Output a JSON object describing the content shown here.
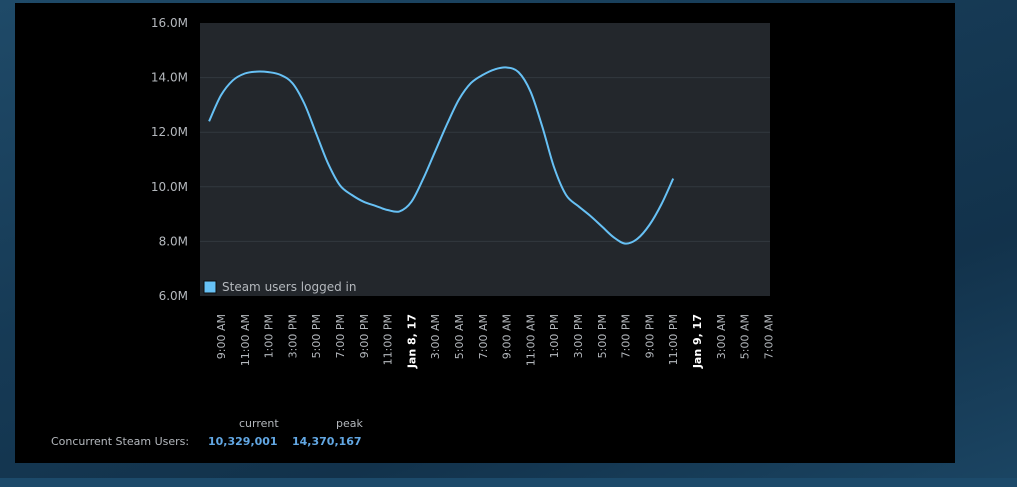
{
  "chart_data": {
    "type": "line",
    "title": "",
    "xlabel": "",
    "ylabel": "",
    "ylim": [
      6.0,
      16.0
    ],
    "y_unit": "M",
    "y_ticks": [
      "16.0M",
      "14.0M",
      "12.0M",
      "10.0M",
      "8.0M",
      "6.0M"
    ],
    "y_tick_values": [
      16.0,
      14.0,
      12.0,
      10.0,
      8.0,
      6.0
    ],
    "x_tick_labels": [
      {
        "label": "9:00 AM",
        "bold": false
      },
      {
        "label": "11:00 AM",
        "bold": false
      },
      {
        "label": "1:00 PM",
        "bold": false
      },
      {
        "label": "3:00 PM",
        "bold": false
      },
      {
        "label": "5:00 PM",
        "bold": false
      },
      {
        "label": "7:00 PM",
        "bold": false
      },
      {
        "label": "9:00 PM",
        "bold": false
      },
      {
        "label": "11:00 PM",
        "bold": false
      },
      {
        "label": "Jan 8, 17",
        "bold": true
      },
      {
        "label": "3:00 AM",
        "bold": false
      },
      {
        "label": "5:00 AM",
        "bold": false
      },
      {
        "label": "7:00 AM",
        "bold": false
      },
      {
        "label": "9:00 AM",
        "bold": false
      },
      {
        "label": "11:00 AM",
        "bold": false
      },
      {
        "label": "1:00 PM",
        "bold": false
      },
      {
        "label": "3:00 PM",
        "bold": false
      },
      {
        "label": "5:00 PM",
        "bold": false
      },
      {
        "label": "7:00 PM",
        "bold": false
      },
      {
        "label": "9:00 PM",
        "bold": false
      },
      {
        "label": "11:00 PM",
        "bold": false
      },
      {
        "label": "Jan 9, 17",
        "bold": true
      },
      {
        "label": "3:00 AM",
        "bold": false
      },
      {
        "label": "5:00 AM",
        "bold": false
      },
      {
        "label": "7:00 AM",
        "bold": false
      }
    ],
    "legend": {
      "position": "bottom-left",
      "entries": [
        "Steam users logged in"
      ]
    },
    "grid": true,
    "series": [
      {
        "name": "Steam users logged in",
        "color": "#67c1f5",
        "points": [
          [
            "Jan 7, 17 8:00 AM",
            12.4
          ],
          [
            "Jan 7, 17 9:00 AM",
            13.35
          ],
          [
            "Jan 7, 17 10:00 AM",
            13.9
          ],
          [
            "Jan 7, 17 11:00 AM",
            14.15
          ],
          [
            "Jan 7, 17 12:00 PM",
            14.22
          ],
          [
            "Jan 7, 17 1:00 PM",
            14.2
          ],
          [
            "Jan 7, 17 2:00 PM",
            14.1
          ],
          [
            "Jan 7, 17 3:00 PM",
            13.8
          ],
          [
            "Jan 7, 17 4:00 PM",
            13.05
          ],
          [
            "Jan 7, 17 5:00 PM",
            11.95
          ],
          [
            "Jan 7, 17 6:00 PM",
            10.85
          ],
          [
            "Jan 7, 17 7:00 PM",
            10.05
          ],
          [
            "Jan 7, 17 8:00 PM",
            9.7
          ],
          [
            "Jan 7, 17 9:00 PM",
            9.45
          ],
          [
            "Jan 7, 17 10:00 PM",
            9.3
          ],
          [
            "Jan 7, 17 11:00 PM",
            9.15
          ],
          [
            "Jan 8, 17 12:00 AM",
            9.1
          ],
          [
            "Jan 8, 17 1:00 AM",
            9.45
          ],
          [
            "Jan 8, 17 2:00 AM",
            10.3
          ],
          [
            "Jan 8, 17 3:00 AM",
            11.3
          ],
          [
            "Jan 8, 17 4:00 AM",
            12.3
          ],
          [
            "Jan 8, 17 5:00 AM",
            13.2
          ],
          [
            "Jan 8, 17 6:00 AM",
            13.8
          ],
          [
            "Jan 8, 17 7:00 AM",
            14.1
          ],
          [
            "Jan 8, 17 8:00 AM",
            14.3
          ],
          [
            "Jan 8, 17 9:00 AM",
            14.37
          ],
          [
            "Jan 8, 17 10:00 AM",
            14.2
          ],
          [
            "Jan 8, 17 11:00 AM",
            13.5
          ],
          [
            "Jan 8, 17 12:00 PM",
            12.2
          ],
          [
            "Jan 8, 17 1:00 PM",
            10.7
          ],
          [
            "Jan 8, 17 2:00 PM",
            9.7
          ],
          [
            "Jan 8, 17 3:00 PM",
            9.3
          ],
          [
            "Jan 8, 17 4:00 PM",
            8.95
          ],
          [
            "Jan 8, 17 5:00 PM",
            8.55
          ],
          [
            "Jan 8, 17 6:00 PM",
            8.15
          ],
          [
            "Jan 8, 17 7:00 PM",
            7.92
          ],
          [
            "Jan 8, 17 8:00 PM",
            8.1
          ],
          [
            "Jan 8, 17 9:00 PM",
            8.6
          ],
          [
            "Jan 8, 17 10:00 PM",
            9.35
          ],
          [
            "Jan 8, 17 11:00 PM",
            10.3
          ]
        ]
      }
    ]
  },
  "stats": {
    "header_current": "current",
    "header_peak": "peak",
    "row_label": "Concurrent Steam Users:",
    "current_value": "10,329,001",
    "peak_value": "14,370,167"
  },
  "colors": {
    "plot_background": "#23272c",
    "line": "#67c1f5",
    "panel": "#000000",
    "stat_value": "#62a7e3",
    "axis_text": "#b4b8bd"
  }
}
